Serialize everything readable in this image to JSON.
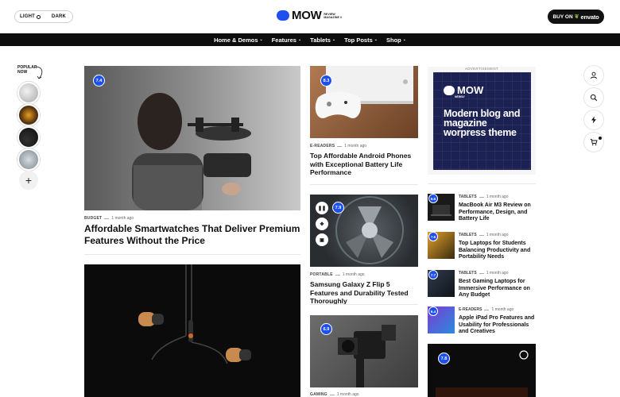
{
  "header": {
    "mode_light": "LIGHT",
    "mode_dark": "DARK",
    "logo_text": "MOW",
    "logo_sub": "REVIEW MAGAZINE //",
    "buy_label": "BUY ON",
    "buy_brand": "envato"
  },
  "nav": {
    "items": [
      {
        "label": "Home & Demos"
      },
      {
        "label": "Features"
      },
      {
        "label": "Tablets"
      },
      {
        "label": "Top Posts"
      },
      {
        "label": "Shop"
      }
    ]
  },
  "rail": {
    "popular_label": "POPULAR NOW",
    "add_label": "+"
  },
  "featured": {
    "score": "7.4",
    "category": "BUDGET",
    "time": "1 month ago",
    "title": "Affordable Smartwatches That Deliver Premium Features Without the Price"
  },
  "second_large": {},
  "middle": [
    {
      "score": "8.3",
      "category": "E-READERS",
      "time": "1 month ago",
      "title": "Top Affordable Android Phones with Exceptional Battery Life Performance"
    },
    {
      "score": "7.9",
      "category": "PORTABLE",
      "time": "1 month ago",
      "title": "Samsung Galaxy Z Flip 5 Features and Durability Tested Thoroughly"
    },
    {
      "score": "6.9",
      "category": "GAMING",
      "time": "1 month ago",
      "title": ""
    }
  ],
  "ad": {
    "label": "ADVERTISEMENT",
    "logo": "MOW",
    "news": "NEWS//",
    "text": "Modern blog and magazine worpress theme"
  },
  "small_list": [
    {
      "score": "6.6",
      "category": "TABLETS",
      "time": "1 month ago",
      "title": "MacBook Air M3 Review on Performance, Design, and Battery Life"
    },
    {
      "score": "7.6",
      "category": "TABLETS",
      "time": "1 month ago",
      "title": "Top Laptops for Students Balancing Productivity and Portability Needs"
    },
    {
      "score": "7.7",
      "category": "TABLETS",
      "time": "1 month ago",
      "title": "Best Gaming Laptops for Immersive Performance on Any Budget"
    },
    {
      "score": "6.4",
      "category": "E-READERS",
      "time": "1 month ago",
      "title": "Apple iPad Pro Features and Usability for Professionals and Creatives"
    }
  ],
  "bottom_right": {
    "score": "7.8"
  },
  "icons": [
    "user-icon",
    "search-icon",
    "bolt-icon",
    "cart-icon"
  ],
  "colors": {
    "accent": "#1e50f0",
    "nav_bg": "#0d0d0d"
  }
}
